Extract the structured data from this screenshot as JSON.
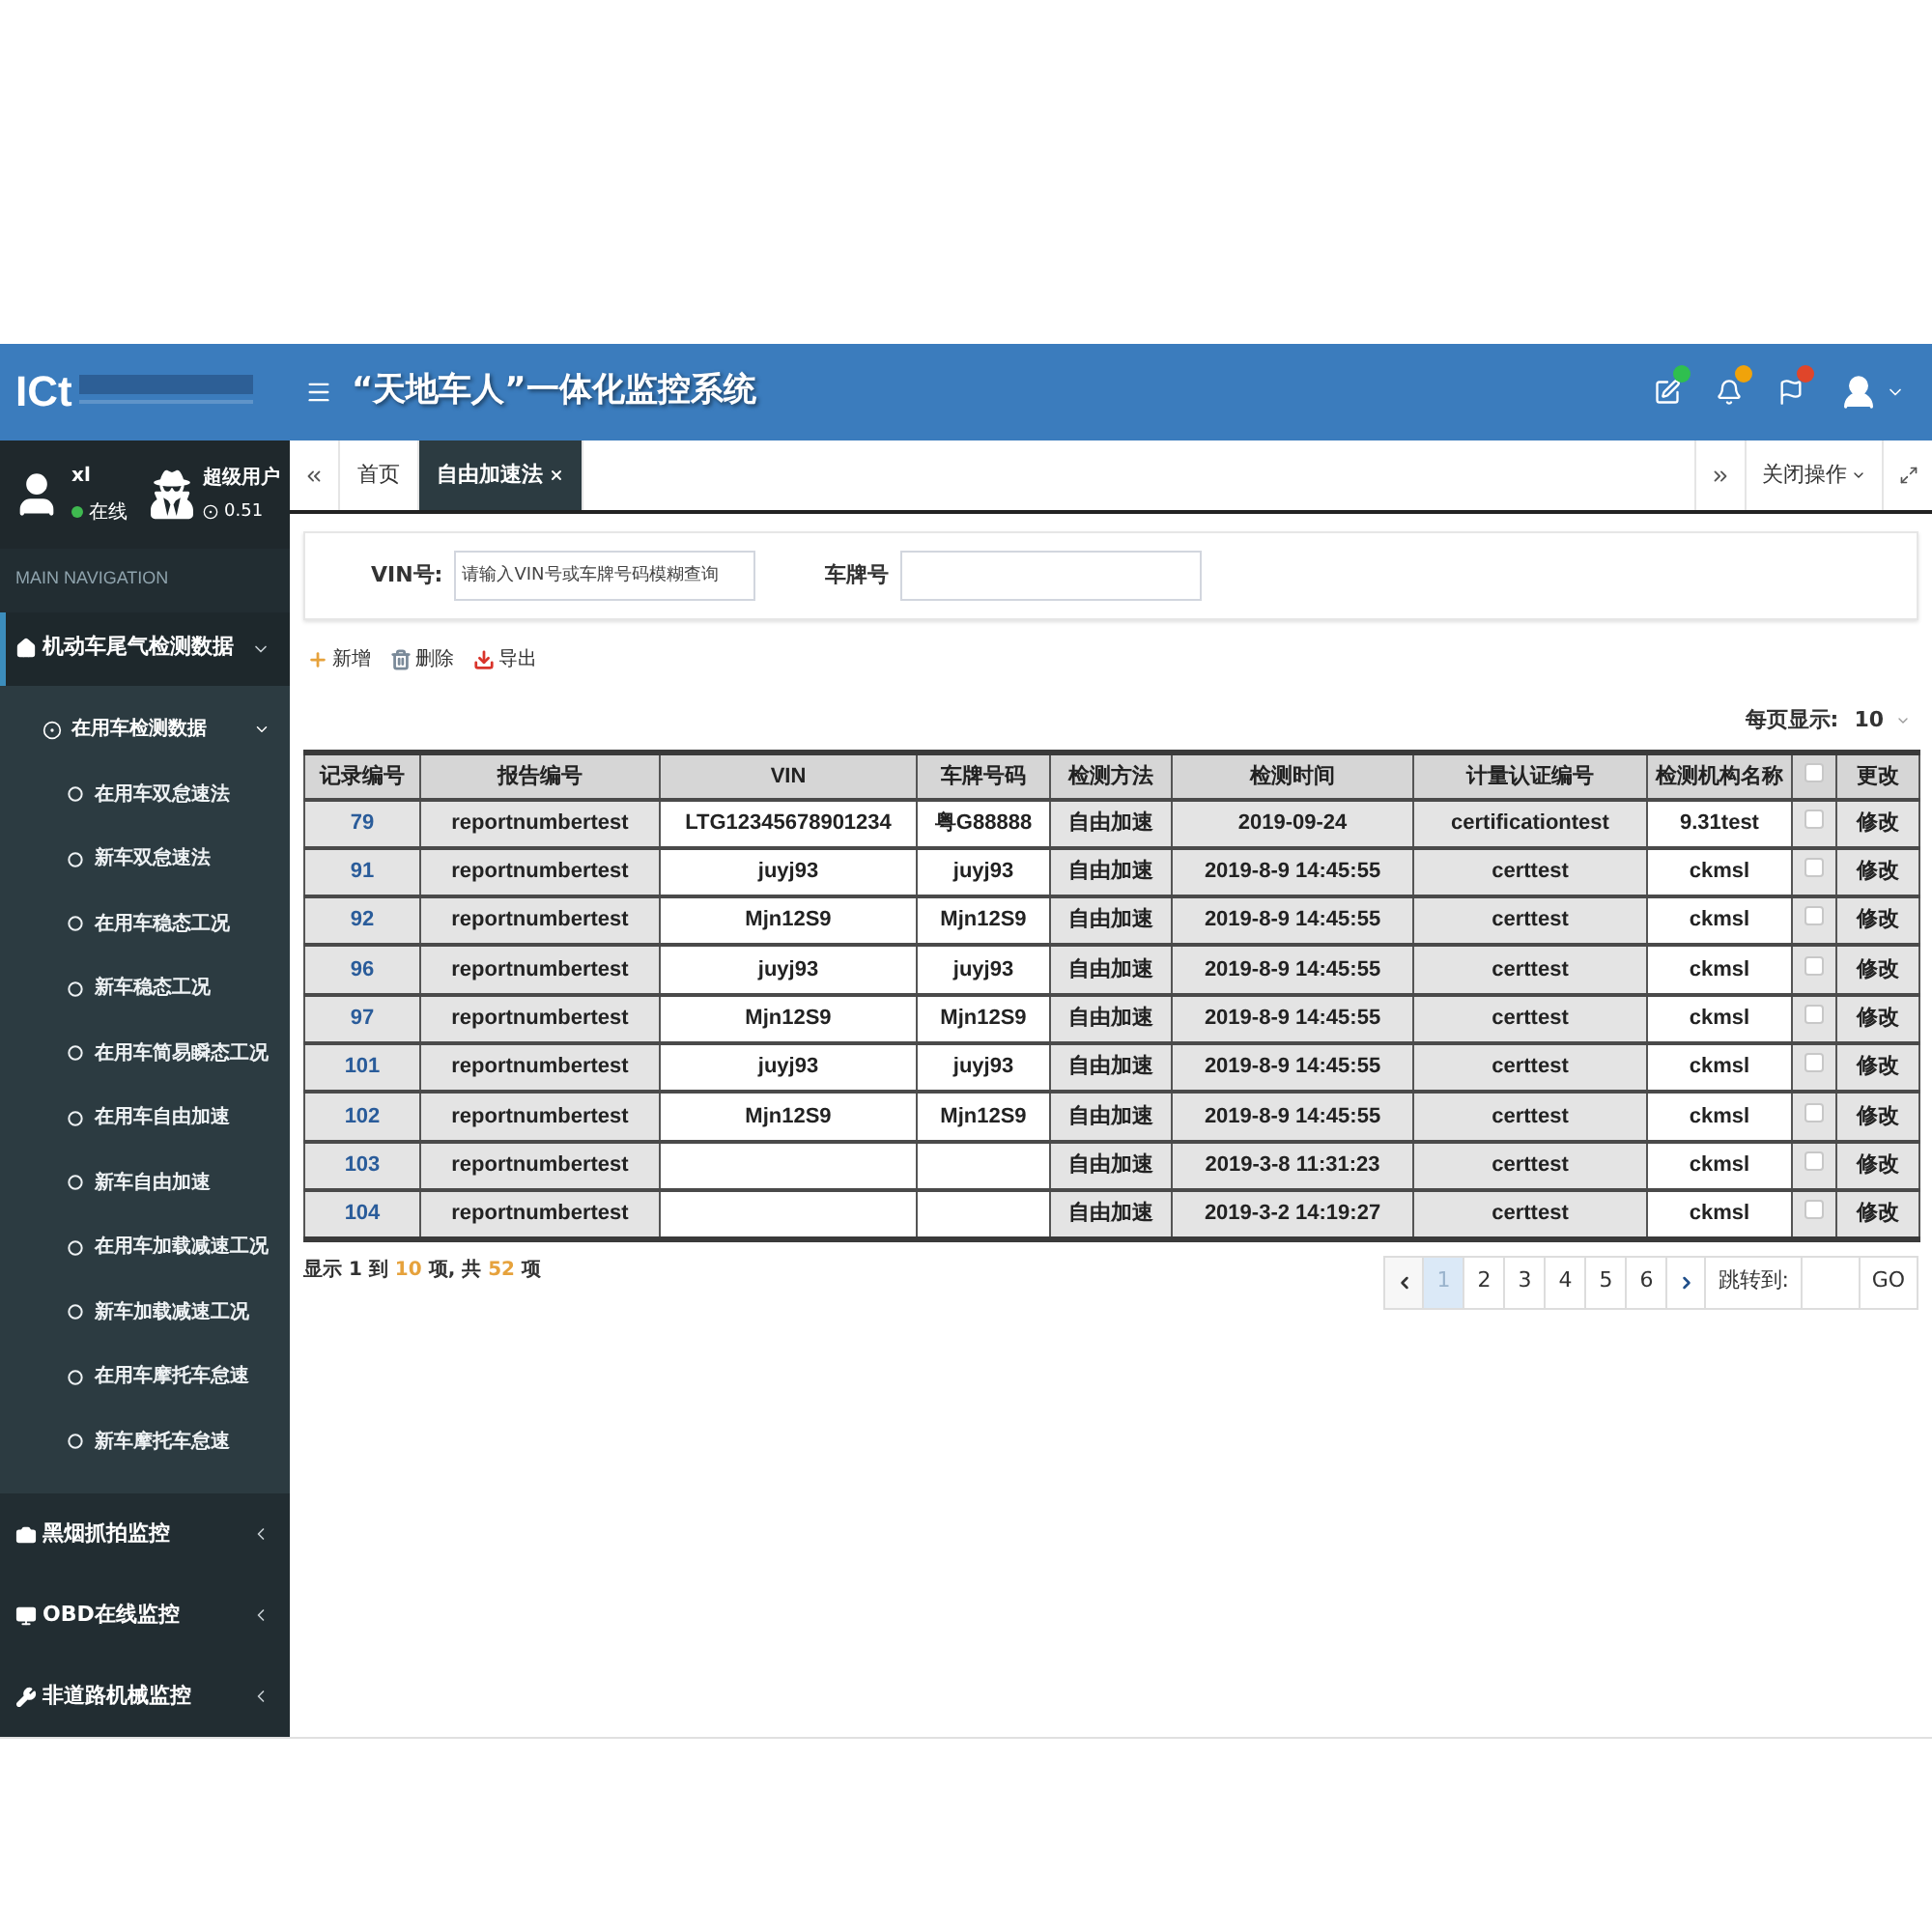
{
  "header": {
    "logo_text": "ICt",
    "title": "“天地车人”一体化监控系统",
    "notifications": [
      {
        "color": "#2fbf4f"
      },
      {
        "color": "#f0a30a"
      },
      {
        "color": "#e0452a"
      }
    ]
  },
  "sidebar": {
    "user": {
      "name": "xl",
      "status": "在线"
    },
    "admin": {
      "name": "超级用户",
      "info": "0.51"
    },
    "nav_header": "MAIN NAVIGATION",
    "menu": [
      {
        "label": "机动车尾气检测数据",
        "selected": true,
        "expanded": true,
        "children": [
          {
            "label": "在用车检测数据",
            "expanded": true,
            "children": [
              {
                "label": "在用车双怠速法",
                "selected": false
              },
              {
                "label": "新车双怠速法",
                "selected": false
              },
              {
                "label": "在用车稳态工况",
                "selected": false
              },
              {
                "label": "新车稳态工况",
                "selected": false
              },
              {
                "label": "在用车简易瞬态工况",
                "selected": false
              },
              {
                "label": "在用车自由加速",
                "selected": false
              },
              {
                "label": "新车自由加速",
                "selected": false
              },
              {
                "label": "在用车加载减速工况",
                "selected": false
              },
              {
                "label": "新车加载减速工况",
                "selected": false
              },
              {
                "label": "在用车摩托车怠速",
                "selected": false
              },
              {
                "label": "新车摩托车怠速",
                "selected": false
              }
            ]
          }
        ]
      },
      {
        "label": "黑烟抓拍监控",
        "selected": false,
        "expanded": false
      },
      {
        "label": "OBD在线监控",
        "selected": false,
        "expanded": false
      },
      {
        "label": "非道路机械监控",
        "selected": false,
        "expanded": false
      }
    ]
  },
  "tabs": {
    "items": [
      {
        "label": "首页",
        "selected": false,
        "closable": false
      },
      {
        "label": "自由加速法",
        "selected": true,
        "closable": true
      }
    ],
    "close_menu": "关闭操作"
  },
  "search": {
    "fields": [
      {
        "label": "VIN号:",
        "placeholder": "请输入VIN号或车牌号码模糊查询"
      },
      {
        "label": "车牌号"
      }
    ]
  },
  "toolbar": [
    {
      "label": "新增"
    },
    {
      "label": "删除"
    },
    {
      "label": "导出"
    }
  ],
  "page_size": {
    "label": "每页显示:",
    "value": "10"
  },
  "table": {
    "columns": [
      {
        "kind": "text",
        "label": "记录编号"
      },
      {
        "kind": "text",
        "label": "报告编号"
      },
      {
        "kind": "text",
        "label": "VIN"
      },
      {
        "kind": "text",
        "label": "车牌号码"
      },
      {
        "kind": "text",
        "label": "检测方法"
      },
      {
        "kind": "text",
        "label": "检测时间"
      },
      {
        "kind": "text",
        "label": "计量认证编号"
      },
      {
        "kind": "text",
        "label": "检测机构名称"
      },
      {
        "kind": "checkbox",
        "checked": false
      },
      {
        "kind": "text",
        "label": "更改"
      }
    ],
    "rows": [
      {
        "record_no": "79",
        "report_no": "reportnumbertest",
        "vin": "LTG12345678901234",
        "plate": "粤G88888",
        "method": "自由加速",
        "time": "2019-09-24",
        "cert_no": "certificationtest",
        "org": "9.31test",
        "checked": false,
        "action": "修改"
      },
      {
        "record_no": "91",
        "report_no": "reportnumbertest",
        "vin": "juyj93",
        "plate": "juyj93",
        "method": "自由加速",
        "time": "2019-8-9 14:45:55",
        "cert_no": "certtest",
        "org": "ckmsl",
        "checked": false,
        "action": "修改"
      },
      {
        "record_no": "92",
        "report_no": "reportnumbertest",
        "vin": "Mjn12S9",
        "plate": "Mjn12S9",
        "method": "自由加速",
        "time": "2019-8-9 14:45:55",
        "cert_no": "certtest",
        "org": "ckmsl",
        "checked": false,
        "action": "修改"
      },
      {
        "record_no": "96",
        "report_no": "reportnumbertest",
        "vin": "juyj93",
        "plate": "juyj93",
        "method": "自由加速",
        "time": "2019-8-9 14:45:55",
        "cert_no": "certtest",
        "org": "ckmsl",
        "checked": false,
        "action": "修改"
      },
      {
        "record_no": "97",
        "report_no": "reportnumbertest",
        "vin": "Mjn12S9",
        "plate": "Mjn12S9",
        "method": "自由加速",
        "time": "2019-8-9 14:45:55",
        "cert_no": "certtest",
        "org": "ckmsl",
        "checked": false,
        "action": "修改"
      },
      {
        "record_no": "101",
        "report_no": "reportnumbertest",
        "vin": "juyj93",
        "plate": "juyj93",
        "method": "自由加速",
        "time": "2019-8-9 14:45:55",
        "cert_no": "certtest",
        "org": "ckmsl",
        "checked": false,
        "action": "修改"
      },
      {
        "record_no": "102",
        "report_no": "reportnumbertest",
        "vin": "Mjn12S9",
        "plate": "Mjn12S9",
        "method": "自由加速",
        "time": "2019-8-9 14:45:55",
        "cert_no": "certtest",
        "org": "ckmsl",
        "checked": false,
        "action": "修改"
      },
      {
        "record_no": "103",
        "report_no": "reportnumbertest",
        "method": "自由加速",
        "time": "2019-3-8 11:31:23",
        "cert_no": "certtest",
        "org": "ckmsl",
        "checked": false,
        "action": "修改"
      },
      {
        "record_no": "104",
        "report_no": "reportnumbertest",
        "method": "自由加速",
        "time": "2019-3-2 14:19:27",
        "cert_no": "certtest",
        "org": "ckmsl",
        "checked": false,
        "action": "修改"
      }
    ]
  },
  "footer": {
    "prefix": "显示 1 到",
    "shown": "10",
    "middle": "项, 共",
    "total": "52",
    "suffix": "项"
  },
  "pagination": {
    "pages": [
      {
        "label": "1",
        "selected": true
      },
      {
        "label": "2",
        "selected": false
      },
      {
        "label": "3",
        "selected": false
      },
      {
        "label": "4",
        "selected": false
      },
      {
        "label": "5",
        "selected": false
      },
      {
        "label": "6",
        "selected": false
      }
    ],
    "jump_label": "跳转到:",
    "go": "GO"
  }
}
